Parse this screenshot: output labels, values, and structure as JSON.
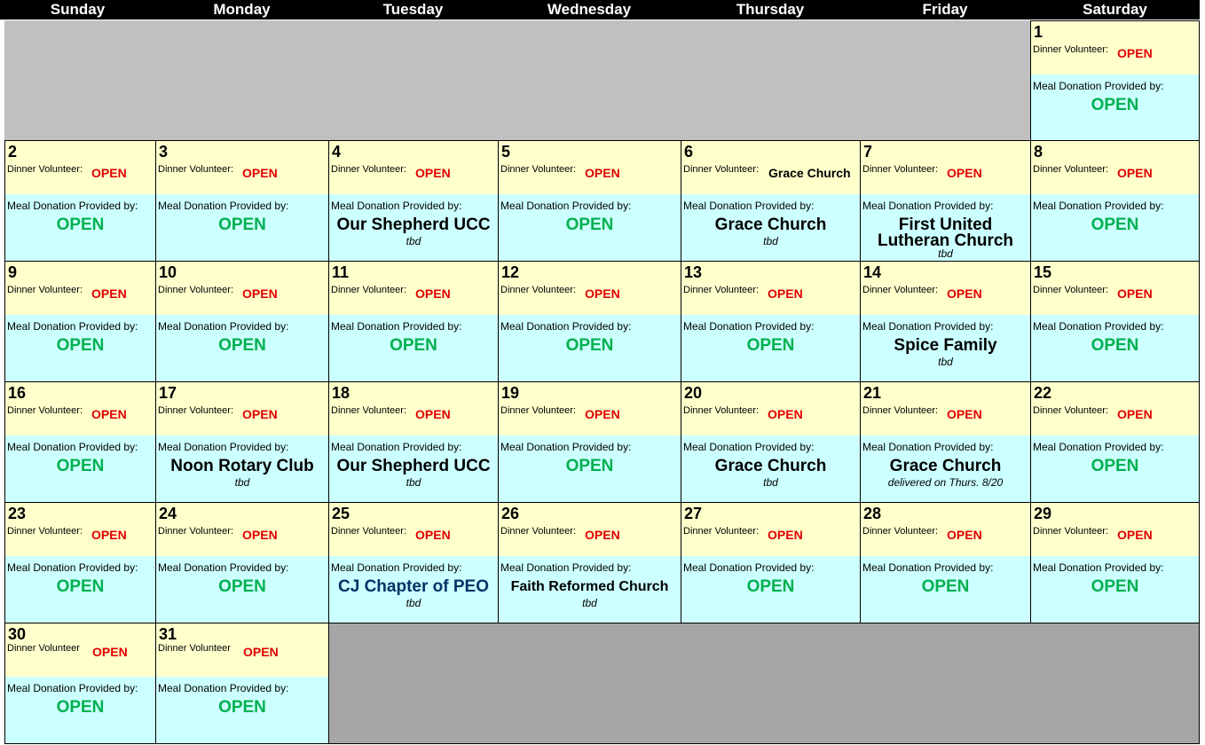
{
  "days": [
    "Sunday",
    "Monday",
    "Tuesday",
    "Wednesday",
    "Thursday",
    "Friday",
    "Saturday"
  ],
  "labels": {
    "dinner_volunteer": "Dinner Volunteer:",
    "dinner_volunteer_nocolon": "Dinner Volunteer",
    "meal_donation": "Meal Donation Provided by:",
    "open": "OPEN"
  },
  "colors": {
    "header_bg": "#000000",
    "volunteer_bg": "#ffffcc",
    "donation_bg": "#ccffff",
    "open_red": "#e00000",
    "open_green": "#00b050",
    "empty_gray": "#c0c0c0"
  },
  "cells": [
    {
      "date": "1",
      "volunteer": "OPEN",
      "donor": "OPEN",
      "note": ""
    },
    {
      "date": "2",
      "volunteer": "OPEN",
      "donor": "OPEN",
      "note": ""
    },
    {
      "date": "3",
      "volunteer": "OPEN",
      "donor": "OPEN",
      "note": ""
    },
    {
      "date": "4",
      "volunteer": "OPEN",
      "donor": "Our Shepherd UCC",
      "note": "tbd"
    },
    {
      "date": "5",
      "volunteer": "OPEN",
      "donor": "OPEN",
      "note": ""
    },
    {
      "date": "6",
      "volunteer": "Grace Church",
      "donor": "Grace Church",
      "note": "tbd"
    },
    {
      "date": "7",
      "volunteer": "OPEN",
      "donor": "First United Lutheran Church",
      "donor_line1": "First United",
      "donor_line2": "Lutheran Church",
      "note": "tbd"
    },
    {
      "date": "8",
      "volunteer": "OPEN",
      "donor": "OPEN",
      "note": ""
    },
    {
      "date": "9",
      "volunteer": "OPEN",
      "donor": "OPEN",
      "note": ""
    },
    {
      "date": "10",
      "volunteer": "OPEN",
      "donor": "OPEN",
      "note": ""
    },
    {
      "date": "11",
      "volunteer": "OPEN",
      "donor": "OPEN",
      "note": ""
    },
    {
      "date": "12",
      "volunteer": "OPEN",
      "donor": "OPEN",
      "note": ""
    },
    {
      "date": "13",
      "volunteer": "OPEN",
      "donor": "OPEN",
      "note": ""
    },
    {
      "date": "14",
      "volunteer": "OPEN",
      "donor": "Spice Family",
      "note": "tbd"
    },
    {
      "date": "15",
      "volunteer": "OPEN",
      "donor": "OPEN",
      "note": ""
    },
    {
      "date": "16",
      "volunteer": "OPEN",
      "donor": "OPEN",
      "note": ""
    },
    {
      "date": "17",
      "volunteer": "OPEN",
      "donor": "Noon Rotary Club",
      "note": "tbd"
    },
    {
      "date": "18",
      "volunteer": "OPEN",
      "donor": "Our Shepherd UCC",
      "note": "tbd"
    },
    {
      "date": "19",
      "volunteer": "OPEN",
      "donor": "OPEN",
      "note": ""
    },
    {
      "date": "20",
      "volunteer": "OPEN",
      "donor": "Grace Church",
      "note": "tbd"
    },
    {
      "date": "21",
      "volunteer": "OPEN",
      "donor": "Grace Church",
      "note": "delivered on Thurs. 8/20"
    },
    {
      "date": "22",
      "volunteer": "OPEN",
      "donor": "OPEN",
      "note": ""
    },
    {
      "date": "23",
      "volunteer": "OPEN",
      "donor": "OPEN",
      "note": ""
    },
    {
      "date": "24",
      "volunteer": "OPEN",
      "donor": "OPEN",
      "note": ""
    },
    {
      "date": "25",
      "volunteer": "OPEN",
      "donor": "CJ Chapter of PEO",
      "note": "tbd"
    },
    {
      "date": "26",
      "volunteer": "OPEN",
      "donor": "Faith Reformed Church",
      "note": "tbd"
    },
    {
      "date": "27",
      "volunteer": "OPEN",
      "donor": "OPEN",
      "note": ""
    },
    {
      "date": "28",
      "volunteer": "OPEN",
      "donor": "OPEN",
      "note": ""
    },
    {
      "date": "29",
      "volunteer": "OPEN",
      "donor": "OPEN",
      "note": ""
    },
    {
      "date": "30",
      "volunteer": "OPEN",
      "donor": "OPEN",
      "note": ""
    },
    {
      "date": "31",
      "volunteer": "OPEN",
      "donor": "OPEN",
      "note": ""
    }
  ]
}
